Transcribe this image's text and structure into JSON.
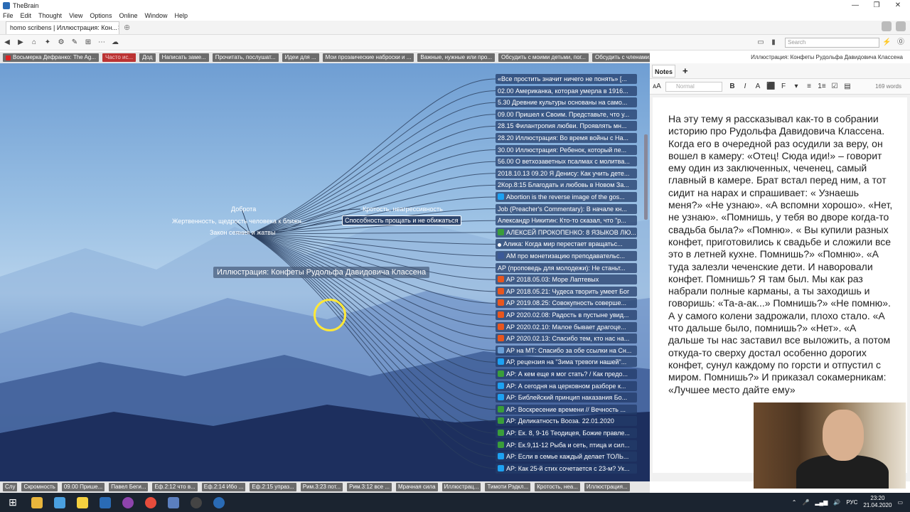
{
  "app": {
    "title": "TheBrain"
  },
  "window_controls": [
    "—",
    "❐",
    "✕"
  ],
  "menu": [
    "File",
    "Edit",
    "Thought",
    "View",
    "Options",
    "Online",
    "Window",
    "Help"
  ],
  "tab": {
    "label": "homo scribens | Иллюстрация: Кон...",
    "close": "✕",
    "add": "⊕"
  },
  "search": {
    "placeholder": "Search"
  },
  "toolbar_icons": [
    "◀",
    "▶",
    "⌂",
    "✦",
    "⚙",
    "✎",
    "⊞",
    "⋯",
    "☁"
  ],
  "toolbar_right_icons": [
    "▭",
    "▮",
    "⚡",
    "⓪"
  ],
  "pins": [
    {
      "label": "Восьмерка Дефранко: The Ag...",
      "icon": "red-square"
    },
    {
      "label": "Часто ис...",
      "style": "red"
    },
    {
      "label": "Дод"
    },
    {
      "label": "Написать заме..."
    },
    {
      "label": "Прочитать, послушат..."
    },
    {
      "label": "Идеи для ..."
    },
    {
      "label": "Мои прозаические наброски и ..."
    },
    {
      "label": "Важные, нужные или про..."
    },
    {
      "label": "Обсудить с моими детьми, пог..."
    },
    {
      "label": "Обсудить с членами..."
    }
  ],
  "breadcrumb": "Иллюстрация: Конфеты Рудольфа Давидовича Классена",
  "plex": {
    "central": "Иллюстрация: Конфеты Рудольфа Давидовича Классена",
    "parents": [
      {
        "label": "Доброта"
      },
      {
        "label": "Жертвенность, щедрость человека к ближн..."
      },
      {
        "label": "Закон сеяния и жатвы"
      }
    ],
    "jumps": [
      {
        "label": "Кротость, неагрессивность"
      },
      {
        "label": "Способность прощать и не обижаться"
      }
    ],
    "children": [
      {
        "label": "«Все простить значит ничего не понять» [...",
        "icon": ""
      },
      {
        "label": "02.00 Американка, которая умерла в 1916...",
        "icon": ""
      },
      {
        "label": "5.30 Древние культуры основаны на само...",
        "icon": ""
      },
      {
        "label": "09.00 Пришел к Своим. Представьте, что у...",
        "icon": ""
      },
      {
        "label": "28.15 Филантропия любви. Проявлять мн...",
        "icon": ""
      },
      {
        "label": "28.20 Иллюстрация: Во время войны с На...",
        "icon": ""
      },
      {
        "label": "30.00 Иллюстрация: Ребенок, который пе...",
        "icon": ""
      },
      {
        "label": "56.00 О ветхозаветных псалмах с молитва...",
        "icon": ""
      },
      {
        "label": "2018.10.13 09.20 Я Денису: Как учить дете...",
        "icon": ""
      },
      {
        "label": "2Кор.8:15 Благодать и любовь в Новом За...",
        "icon": ""
      },
      {
        "label": "Abortion is the reverse image of the gos...",
        "icon": "twitter"
      },
      {
        "label": "Job (Preacher's Commentary): В начале кн...",
        "icon": ""
      },
      {
        "label": "Александр Никитин: Кто-то сказал, что \"р...",
        "icon": ""
      },
      {
        "label": "АЛЕКСЕЙ ПРОКОПЕНКО: 8 ЯЗЫКОВ ЛЮ...",
        "icon": "green"
      },
      {
        "label": "Алика:  Когда мир перестает вращатьс...",
        "icon": "dot"
      },
      {
        "label": "АМ про монетизацию преподавательс...",
        "icon": "facebook"
      },
      {
        "label": "АР (проповедь для молодежи): Не станьт...",
        "icon": ""
      },
      {
        "label": "АР 2018.05.03: Море Лаптевых",
        "icon": "orange"
      },
      {
        "label": "АР 2018.05.21: Чудеса творить умеет Бог",
        "icon": "orange"
      },
      {
        "label": "АР 2019.08.25: Совокупность совершe...",
        "icon": "orange"
      },
      {
        "label": "АР 2020.02.08: Радость в пустыне увид...",
        "icon": "orange"
      },
      {
        "label": "АР 2020.02.10: Малое бывает драгоце...",
        "icon": "orange"
      },
      {
        "label": "АР 2020.02.13: Спасибо тем, кто нас на...",
        "icon": "orange"
      },
      {
        "label": "АР на МТ: Спасибо за обе ссылки на Сн...",
        "icon": "stripe"
      },
      {
        "label": "АР, рецензия на \"Зима тревоги нашей\"...",
        "icon": "twitter"
      },
      {
        "label": "АР: А кем еще я мог стать? / Как предо...",
        "icon": "green"
      },
      {
        "label": "АР: А сегодня на церковном разборе к...",
        "icon": "twitter"
      },
      {
        "label": "АР: Библейский принцип наказания Бо...",
        "icon": "twitter"
      },
      {
        "label": "АР: Воскресение времени // Вечность ...",
        "icon": "green"
      },
      {
        "label": "АР: Деликатность Вооза. 22.01.2020",
        "icon": "green"
      },
      {
        "label": "АР: Ек. 8, 9-16 Теодицея, Божие правле...",
        "icon": "green"
      },
      {
        "label": "АР: Ек.9,11-12 Рыба и сеть, птица и сил...",
        "icon": "green"
      },
      {
        "label": "АР: Если в семье каждый делает ТОЛЬ...",
        "icon": "twitter"
      },
      {
        "label": "АР: Как 25-й стих сочетается с 23-м? Ук...",
        "icon": "twitter"
      }
    ]
  },
  "bottom_items": [
    "Слу",
    "Скромность",
    "09.00 Прише...",
    "Павел Беги...",
    "Еф.2:12 что в...",
    "Еф.2:14 Ибо ...",
    "Еф.2:15 упраз...",
    "Рим.3:23 пот...",
    "Рим.3:12 все ...",
    "Мрачная сила",
    "Иллюстрац...",
    "Тимоти Рэдкл...",
    "Кротость, неа...",
    "Иллюстрация..."
  ],
  "notes": {
    "tab": "Notes",
    "add": "+",
    "style_placeholder": "Normal",
    "toolbar_buttons": [
      "B",
      "I",
      "A",
      "⬛",
      "F",
      "▾",
      "≡",
      "1≡",
      "☑",
      "▤"
    ],
    "word_count": "169 words",
    "text": "На эту тему я рассказывал как-то в собрании историю про Рудольфа Давидовича Классена. Когда его в очередной раз осудили за веру, он вошел в камеру: «Отец! Сюда иди!» – говорит ему один из заключенных, чеченец, самый главный в камере. Брат встал перед ним, а тот сидит на нарах и спрашивает: « Узнаешь меня?» «Не узнаю». «А вспомни хорошо». «Нет, не узнаю». «Помнишь, у тебя во дворе когда-то свадьба была?» «Помню». « Вы купили разных конфет, приготовились к свадьбе и сложили все это в летней кухне. Помнишь?» «Помню». «А туда залезли чеченские дети. И наворовали конфет. Помнишь? Я там был. Мы как раз набрали полные карманы, а ты заходишь и говоришь: «Та-а-ак...» Помнишь?» «Не помню». А у самого колени задрожали, плохо стало. «А что дальше было, помнишь?» «Нет». «А дальше ты нас заставил все выложить, а потом откуда-то сверху достал особенно дорогих конфет, сунул каждому по горсти и отпустил с миром. Помнишь?» И приказал сокамерникам: «Лучшее место дайте ему»"
  },
  "taskbar": {
    "tray_lang": "РУС",
    "time": "23:20",
    "date": "21.04.2020"
  },
  "colors": {
    "accent": "#2a6bb5",
    "node_bg": "#233c69",
    "taskbar": "#1b2430"
  }
}
